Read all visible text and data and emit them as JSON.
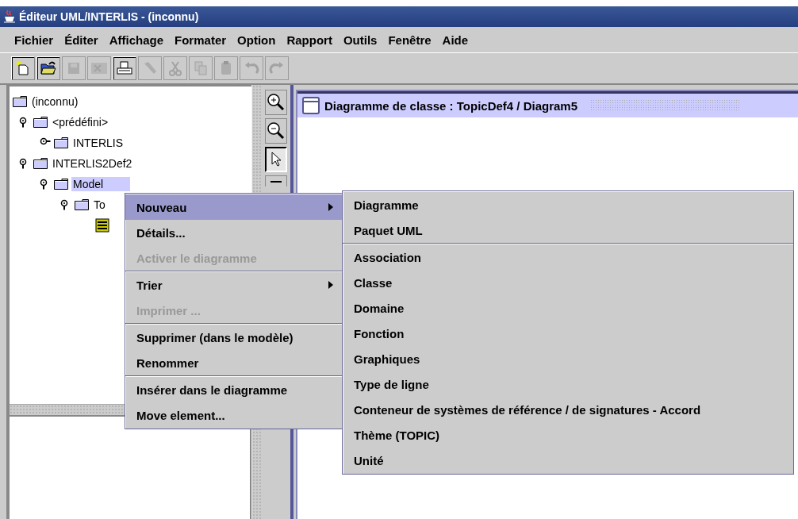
{
  "window": {
    "title": "Éditeur UML/INTERLIS - (inconnu)"
  },
  "menu_bar": [
    "Fichier",
    "Éditer",
    "Affichage",
    "Formater",
    "Option",
    "Rapport",
    "Outils",
    "Fenêtre",
    "Aide"
  ],
  "toolbar": [
    {
      "kind": "new",
      "disabled": false
    },
    {
      "kind": "open",
      "disabled": false
    },
    {
      "kind": "save",
      "disabled": true
    },
    {
      "kind": "close",
      "disabled": true
    },
    {
      "kind": "print",
      "disabled": false
    },
    {
      "kind": "brush",
      "disabled": true
    },
    {
      "kind": "cut",
      "disabled": true
    },
    {
      "kind": "copy",
      "disabled": true
    },
    {
      "kind": "paste",
      "disabled": true
    },
    {
      "kind": "undo",
      "disabled": true
    },
    {
      "kind": "redo",
      "disabled": true
    }
  ],
  "tree": {
    "label": "(inconnu)",
    "selected": false,
    "children": [
      {
        "label": "<prédéfini>",
        "expanded": true,
        "selected": false,
        "children": [
          {
            "label": "INTERLIS",
            "expanded": false,
            "selected": false
          }
        ]
      },
      {
        "label": "INTERLIS2Def2",
        "expanded": true,
        "selected": false,
        "children": [
          {
            "label": "Model",
            "expanded": true,
            "selected": true,
            "children": [
              {
                "label": "To",
                "expanded": true,
                "selected": false,
                "children": [
                  {
                    "kind": "diagram",
                    "selected": false
                  }
                ]
              }
            ]
          }
        ]
      }
    ]
  },
  "diagram_tools": [
    {
      "kind": "zoom-in",
      "selected": false
    },
    {
      "kind": "zoom-out",
      "selected": false
    },
    {
      "kind": "pointer",
      "selected": true
    },
    {
      "kind": "partial",
      "selected": false
    }
  ],
  "diagram_window": {
    "title": "Diagramme de classe : TopicDef4 / Diagram5"
  },
  "context_menu": {
    "groups": [
      [
        {
          "label": "Nouveau",
          "kind": "submenu",
          "selected": true,
          "disabled": false
        },
        {
          "label": "Détails...",
          "kind": "item",
          "selected": false,
          "disabled": false
        },
        {
          "label": "Activer le diagramme",
          "kind": "item",
          "selected": false,
          "disabled": true
        }
      ],
      [
        {
          "label": "Trier",
          "kind": "submenu",
          "selected": false,
          "disabled": false
        },
        {
          "label": "Imprimer ...",
          "kind": "item",
          "selected": false,
          "disabled": true
        }
      ],
      [
        {
          "label": "Supprimer (dans le modèle)",
          "kind": "item",
          "selected": false,
          "disabled": false
        },
        {
          "label": "Renommer",
          "kind": "item",
          "selected": false,
          "disabled": false
        }
      ],
      [
        {
          "label": "Insérer dans le diagramme",
          "kind": "item",
          "selected": false,
          "disabled": false
        },
        {
          "label": "Move element...",
          "kind": "item",
          "selected": false,
          "disabled": false
        }
      ]
    ]
  },
  "submenu": {
    "groups": [
      [
        {
          "label": "Diagramme",
          "kind": "item",
          "selected": false,
          "disabled": false
        },
        {
          "label": "Paquet UML",
          "kind": "item",
          "selected": false,
          "disabled": false
        }
      ],
      [
        {
          "label": "Association",
          "kind": "item",
          "selected": false,
          "disabled": false
        },
        {
          "label": "Classe",
          "kind": "item",
          "selected": false,
          "disabled": false
        },
        {
          "label": "Domaine",
          "kind": "item",
          "selected": false,
          "disabled": false
        },
        {
          "label": "Fonction",
          "kind": "item",
          "selected": false,
          "disabled": false
        },
        {
          "label": "Graphiques",
          "kind": "item",
          "selected": false,
          "disabled": false
        },
        {
          "label": "Type de ligne",
          "kind": "item",
          "selected": false,
          "disabled": false
        },
        {
          "label": "Conteneur de systèmes de référence / de signatures - Accord",
          "kind": "item",
          "selected": false,
          "disabled": false
        },
        {
          "label": "Thème (TOPIC)",
          "kind": "item",
          "selected": false,
          "disabled": false
        },
        {
          "label": "Unité",
          "kind": "item",
          "selected": false,
          "disabled": false
        }
      ]
    ]
  }
}
